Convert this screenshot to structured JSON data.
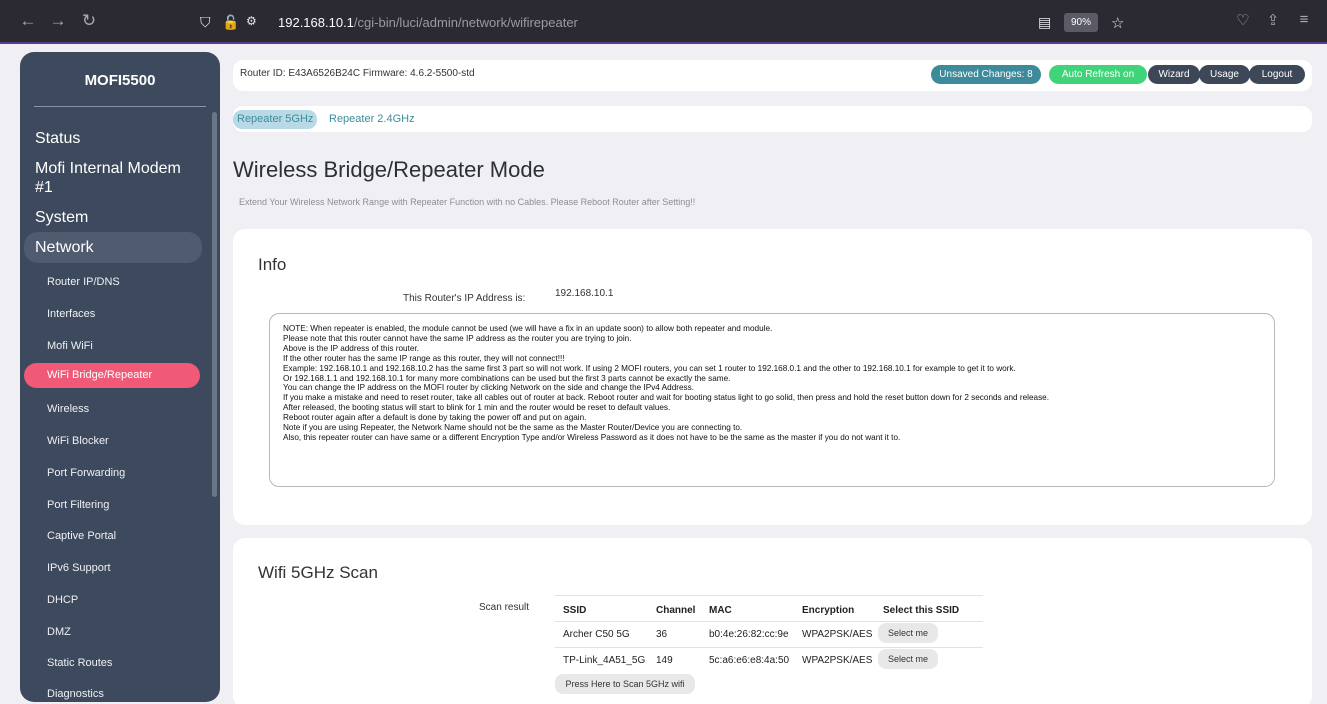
{
  "browser": {
    "url_host": "192.168.10.1",
    "url_path": "/cgi-bin/luci/admin/network/wifirepeater",
    "zoom": "90%"
  },
  "sidebar": {
    "brand": "MOFI5500",
    "top_items": [
      "Status",
      "Mofi Internal Modem #1",
      "System",
      "Network"
    ],
    "sub_items": [
      "Router IP/DNS",
      "Interfaces",
      "Mofi WiFi",
      "WiFi Bridge/Repeater",
      "Wireless",
      "WiFi Blocker",
      "Port Forwarding",
      "Port Filtering",
      "Captive Portal",
      "IPv6 Support",
      "DHCP",
      "DMZ",
      "Static Routes",
      "Diagnostics"
    ]
  },
  "topbar": {
    "router_id_label": "Router ID:",
    "router_id": "E43A6526B24C",
    "firmware_label": "Firmware:",
    "firmware": "4.6.2-5500-std",
    "unsaved": "Unsaved Changes: 8",
    "auto_refresh": "Auto Refresh on",
    "wizard": "Wizard",
    "usage": "Usage",
    "logout": "Logout"
  },
  "tabs": [
    "Repeater 5GHz",
    "Repeater 2.4GHz"
  ],
  "page": {
    "title": "Wireless Bridge/Repeater Mode",
    "subtitle": "Extend Your Wireless Network Range with Repeater Function with no Cables. Please Reboot Router after Setting!!"
  },
  "info": {
    "title": "Info",
    "ip_label": "This Router's IP Address is:",
    "ip_value": "192.168.10.1",
    "notes": [
      "NOTE: When repeater is enabled, the module cannot be used (we will have a fix in an update soon) to allow both repeater and module.",
      "Please note that this router cannot have the same IP address as the router you are trying to join.",
      "Above is the IP address of this router.",
      "If the other router has the same IP range as this router, they will not connect!!!",
      "Example: 192.168.10.1 and 192.168.10.2 has the same first 3 part so will not work. If using 2 MOFI routers, you can set 1 router to 192.168.0.1 and the other to 192.168.10.1 for example to get it to work.",
      "Or 192.168.1.1 and 192.168.10.1 for many more combinations can be used but the first 3 parts cannot be exactly the same.",
      "You can change the IP address on the MOFI router by clicking Network on the side and change the IPv4 Address.",
      "If you make a mistake and need to reset router, take all cables out of router at back. Reboot router and wait for booting status light to go solid, then press and hold the reset button down for 2 seconds and release.",
      "After released, the booting status will start to blink for 1 min and the router would be reset to default values.",
      "Reboot router again after a default is done by taking the power off and put on again.",
      "Note if you are using Repeater, the Network Name should not be the same as the Master Router/Device you are connecting to.",
      "Also, this repeater router can have same or a different Encryption Type and/or Wireless Password as it does not have to be the same as the master if you do not want it to."
    ]
  },
  "scan": {
    "title": "Wifi 5GHz Scan",
    "result_label": "Scan result",
    "headers": [
      "SSID",
      "Channel",
      "MAC",
      "Encryption",
      "Select this SSID"
    ],
    "rows": [
      {
        "ssid": "Archer C50 5G",
        "channel": "36",
        "mac": "b0:4e:26:82:cc:9e",
        "encryption": "WPA2PSK/AES",
        "select": "Select me"
      },
      {
        "ssid": "TP-Link_4A51_5G",
        "channel": "149",
        "mac": "5c:a6:e6:e8:4a:50",
        "encryption": "WPA2PSK/AES",
        "select": "Select me"
      }
    ],
    "scan_button": "Press Here to Scan 5GHz wifi"
  }
}
